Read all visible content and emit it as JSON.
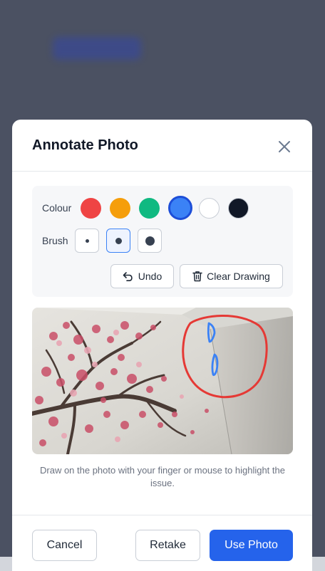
{
  "modal": {
    "title": "Annotate Photo",
    "close_icon": "close-icon"
  },
  "tools": {
    "colour_label": "Colour",
    "brush_label": "Brush",
    "colours": [
      {
        "name": "red",
        "hex": "#ef4444"
      },
      {
        "name": "orange",
        "hex": "#f59e0b"
      },
      {
        "name": "green",
        "hex": "#10b981"
      },
      {
        "name": "blue",
        "hex": "#3b82f6"
      },
      {
        "name": "white",
        "hex": "#ffffff"
      },
      {
        "name": "black",
        "hex": "#111827"
      }
    ],
    "selected_colour": "blue",
    "brushes": [
      "small",
      "medium",
      "large"
    ],
    "selected_brush": "medium",
    "undo_label": "Undo",
    "undo_icon": "undo-icon",
    "clear_label": "Clear Drawing",
    "clear_icon": "trash-icon"
  },
  "photo": {
    "description_icon": "photo",
    "annotation_colours": [
      "#e53935",
      "#3b82f6"
    ]
  },
  "hint": "Draw on the photo with your finger or mouse to highlight the issue.",
  "footer": {
    "cancel_label": "Cancel",
    "retake_label": "Retake",
    "use_label": "Use Photo"
  }
}
